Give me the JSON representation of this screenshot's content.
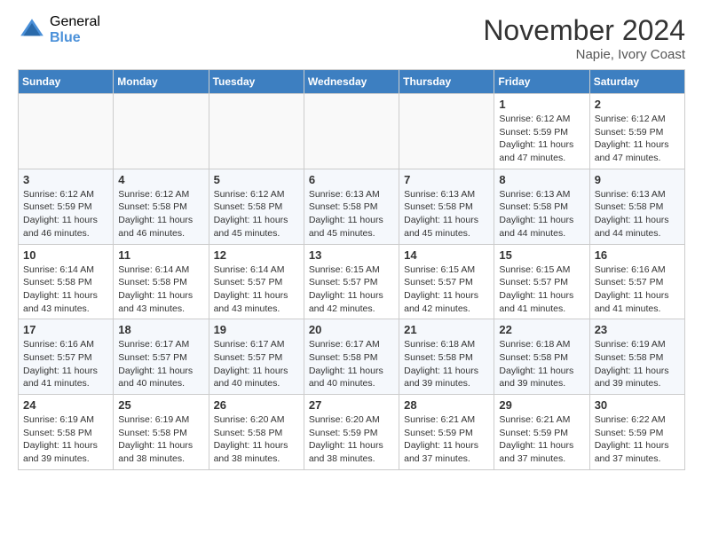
{
  "header": {
    "logo_general": "General",
    "logo_blue": "Blue",
    "month_title": "November 2024",
    "location": "Napie, Ivory Coast"
  },
  "days_of_week": [
    "Sunday",
    "Monday",
    "Tuesday",
    "Wednesday",
    "Thursday",
    "Friday",
    "Saturday"
  ],
  "weeks": [
    [
      {
        "day": "",
        "info": ""
      },
      {
        "day": "",
        "info": ""
      },
      {
        "day": "",
        "info": ""
      },
      {
        "day": "",
        "info": ""
      },
      {
        "day": "",
        "info": ""
      },
      {
        "day": "1",
        "info": "Sunrise: 6:12 AM\nSunset: 5:59 PM\nDaylight: 11 hours and 47 minutes."
      },
      {
        "day": "2",
        "info": "Sunrise: 6:12 AM\nSunset: 5:59 PM\nDaylight: 11 hours and 47 minutes."
      }
    ],
    [
      {
        "day": "3",
        "info": "Sunrise: 6:12 AM\nSunset: 5:59 PM\nDaylight: 11 hours and 46 minutes."
      },
      {
        "day": "4",
        "info": "Sunrise: 6:12 AM\nSunset: 5:58 PM\nDaylight: 11 hours and 46 minutes."
      },
      {
        "day": "5",
        "info": "Sunrise: 6:12 AM\nSunset: 5:58 PM\nDaylight: 11 hours and 45 minutes."
      },
      {
        "day": "6",
        "info": "Sunrise: 6:13 AM\nSunset: 5:58 PM\nDaylight: 11 hours and 45 minutes."
      },
      {
        "day": "7",
        "info": "Sunrise: 6:13 AM\nSunset: 5:58 PM\nDaylight: 11 hours and 45 minutes."
      },
      {
        "day": "8",
        "info": "Sunrise: 6:13 AM\nSunset: 5:58 PM\nDaylight: 11 hours and 44 minutes."
      },
      {
        "day": "9",
        "info": "Sunrise: 6:13 AM\nSunset: 5:58 PM\nDaylight: 11 hours and 44 minutes."
      }
    ],
    [
      {
        "day": "10",
        "info": "Sunrise: 6:14 AM\nSunset: 5:58 PM\nDaylight: 11 hours and 43 minutes."
      },
      {
        "day": "11",
        "info": "Sunrise: 6:14 AM\nSunset: 5:58 PM\nDaylight: 11 hours and 43 minutes."
      },
      {
        "day": "12",
        "info": "Sunrise: 6:14 AM\nSunset: 5:57 PM\nDaylight: 11 hours and 43 minutes."
      },
      {
        "day": "13",
        "info": "Sunrise: 6:15 AM\nSunset: 5:57 PM\nDaylight: 11 hours and 42 minutes."
      },
      {
        "day": "14",
        "info": "Sunrise: 6:15 AM\nSunset: 5:57 PM\nDaylight: 11 hours and 42 minutes."
      },
      {
        "day": "15",
        "info": "Sunrise: 6:15 AM\nSunset: 5:57 PM\nDaylight: 11 hours and 41 minutes."
      },
      {
        "day": "16",
        "info": "Sunrise: 6:16 AM\nSunset: 5:57 PM\nDaylight: 11 hours and 41 minutes."
      }
    ],
    [
      {
        "day": "17",
        "info": "Sunrise: 6:16 AM\nSunset: 5:57 PM\nDaylight: 11 hours and 41 minutes."
      },
      {
        "day": "18",
        "info": "Sunrise: 6:17 AM\nSunset: 5:57 PM\nDaylight: 11 hours and 40 minutes."
      },
      {
        "day": "19",
        "info": "Sunrise: 6:17 AM\nSunset: 5:57 PM\nDaylight: 11 hours and 40 minutes."
      },
      {
        "day": "20",
        "info": "Sunrise: 6:17 AM\nSunset: 5:58 PM\nDaylight: 11 hours and 40 minutes."
      },
      {
        "day": "21",
        "info": "Sunrise: 6:18 AM\nSunset: 5:58 PM\nDaylight: 11 hours and 39 minutes."
      },
      {
        "day": "22",
        "info": "Sunrise: 6:18 AM\nSunset: 5:58 PM\nDaylight: 11 hours and 39 minutes."
      },
      {
        "day": "23",
        "info": "Sunrise: 6:19 AM\nSunset: 5:58 PM\nDaylight: 11 hours and 39 minutes."
      }
    ],
    [
      {
        "day": "24",
        "info": "Sunrise: 6:19 AM\nSunset: 5:58 PM\nDaylight: 11 hours and 39 minutes."
      },
      {
        "day": "25",
        "info": "Sunrise: 6:19 AM\nSunset: 5:58 PM\nDaylight: 11 hours and 38 minutes."
      },
      {
        "day": "26",
        "info": "Sunrise: 6:20 AM\nSunset: 5:58 PM\nDaylight: 11 hours and 38 minutes."
      },
      {
        "day": "27",
        "info": "Sunrise: 6:20 AM\nSunset: 5:59 PM\nDaylight: 11 hours and 38 minutes."
      },
      {
        "day": "28",
        "info": "Sunrise: 6:21 AM\nSunset: 5:59 PM\nDaylight: 11 hours and 37 minutes."
      },
      {
        "day": "29",
        "info": "Sunrise: 6:21 AM\nSunset: 5:59 PM\nDaylight: 11 hours and 37 minutes."
      },
      {
        "day": "30",
        "info": "Sunrise: 6:22 AM\nSunset: 5:59 PM\nDaylight: 11 hours and 37 minutes."
      }
    ]
  ]
}
